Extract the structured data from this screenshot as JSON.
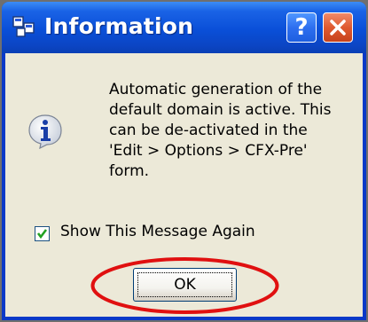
{
  "window": {
    "title": "Information",
    "help_button_glyph": "?",
    "icons": {
      "app": "window-app-icon",
      "help": "help-icon",
      "close": "close-icon"
    }
  },
  "message": {
    "icon": "information-icon",
    "text": "Automatic generation of the\ndefault domain is active. This\ncan be de-activated in the\n'Edit > Options > CFX-Pre'\nform."
  },
  "checkbox": {
    "label": "Show This Message Again",
    "checked": true
  },
  "ok_button": {
    "label": "OK"
  },
  "colors": {
    "titlebar": "#0a4fd8",
    "dialog_background": "#ece9d8",
    "annotation_ellipse": "#e01010"
  }
}
